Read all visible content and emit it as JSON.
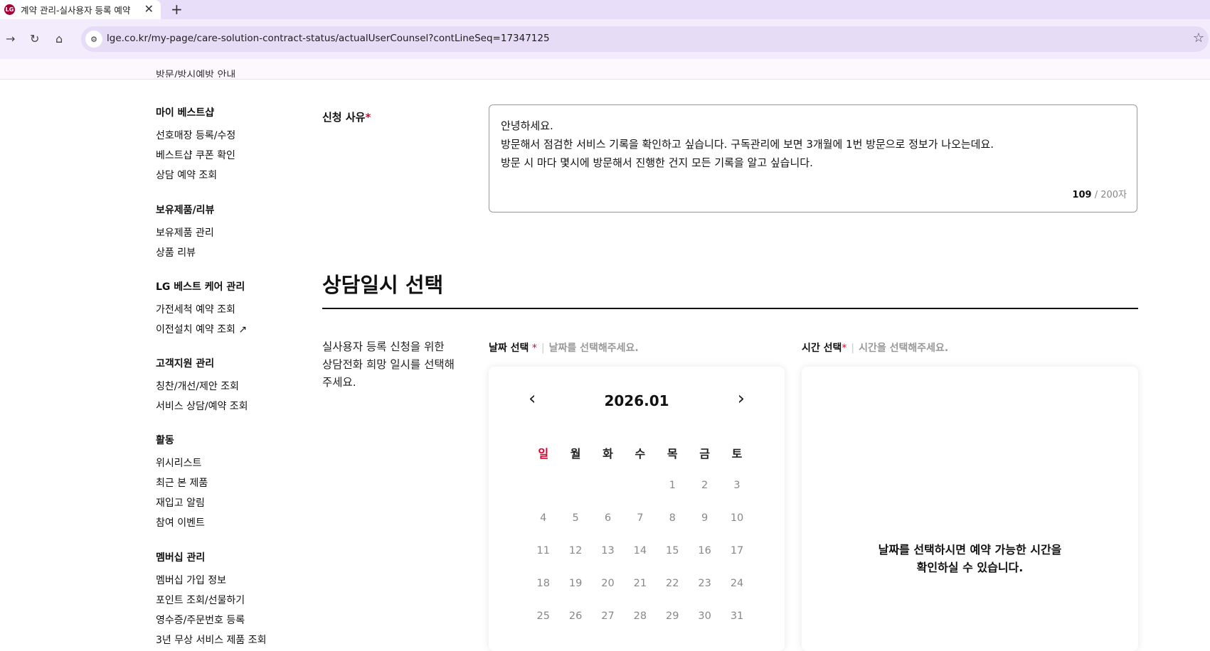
{
  "browser": {
    "tab_title": "계약 관리-실사용자 등록 예약",
    "tab_favicon": "LG",
    "tab_close": "✕",
    "new_tab": "+",
    "url": "lge.co.kr/my-page/care-solution-contract-status/actualUserCounsel?contLineSeq=17347125",
    "back_icon": "←",
    "forward_icon": "→",
    "reload_icon": "↻",
    "home_icon": "⌂",
    "star_icon": "☆"
  },
  "sidebar": {
    "clipped_item": "방문/방시예방 안내",
    "groups": [
      {
        "title": "마이 베스트샵",
        "items": [
          "선호매장 등록/수정",
          "베스트샵 쿠폰 확인",
          "상담 예약 조회"
        ]
      },
      {
        "title": "보유제품/리뷰",
        "items": [
          "보유제품 관리",
          "상품 리뷰"
        ]
      },
      {
        "title": "LG 베스트 케어 관리",
        "items": [
          "가전세척 예약 조회",
          "이전설치 예약 조회 ↗"
        ]
      },
      {
        "title": "고객지원 관리",
        "items": [
          "칭찬/개선/제안 조회",
          "서비스 상담/예약 조회"
        ]
      },
      {
        "title": "활동",
        "items": [
          "위시리스트",
          "최근 본 제품",
          "재입고 알림",
          "참여 이벤트"
        ]
      },
      {
        "title": "멤버십 관리",
        "items": [
          "멤버십 가입 정보",
          "포인트 조회/선물하기",
          "영수증/주문번호 등록",
          "3년 무상 서비스 제품 조회"
        ]
      }
    ]
  },
  "reason": {
    "label": "신청 사유",
    "required_mark": "*",
    "lines": [
      "안녕하세요.",
      "방문해서 점검한 서비스 기록을 확인하고 싶습니다. 구독관리에 보면 3개월에 1번 방문으로 정보가 나오는데요.",
      "방문 시 마다 몇시에 방문해서 진행한 건지 모든 기록을 알고 싶습니다."
    ],
    "count": "109",
    "max": "/ 200자"
  },
  "schedule": {
    "title": "상담일시 선택",
    "description": "실사용자 등록 신청을 위한 상담전화 희망 일시를 선택해 주세요.",
    "date_label": "날짜 선택",
    "date_placeholder": "날짜를 선택해주세요.",
    "time_label": "시간 선택",
    "time_placeholder": "시간을 선택해주세요.",
    "required_mark": "*",
    "separator": "|"
  },
  "calendar": {
    "month": "2026.01",
    "prev_icon": "‹",
    "next_icon": "›",
    "weekdays": [
      "일",
      "월",
      "화",
      "수",
      "목",
      "금",
      "토"
    ],
    "weeks": [
      [
        "",
        "",
        "",
        "",
        "1",
        "2",
        "3"
      ],
      [
        "4",
        "5",
        "6",
        "7",
        "8",
        "9",
        "10"
      ],
      [
        "11",
        "12",
        "13",
        "14",
        "15",
        "16",
        "17"
      ],
      [
        "18",
        "19",
        "20",
        "21",
        "22",
        "23",
        "24"
      ],
      [
        "25",
        "26",
        "27",
        "28",
        "29",
        "30",
        "31"
      ]
    ]
  },
  "time_panel": {
    "message_line1": "날짜를 선택하시면 예약 가능한 시간을",
    "message_line2": "확인하실 수 있습니다."
  }
}
